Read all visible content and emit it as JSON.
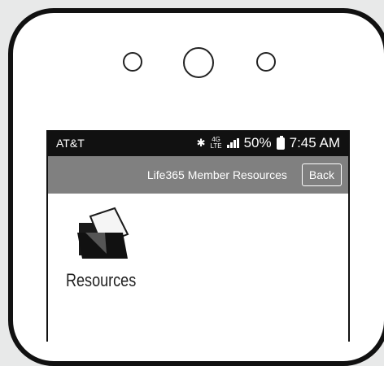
{
  "statusbar": {
    "carrier": "AT&T",
    "network": "4G",
    "network_sub": "LTE",
    "battery_text": "50%",
    "time": "7:45 AM"
  },
  "appbar": {
    "title": "Life365 Member Resources",
    "back_label": "Back"
  },
  "main": {
    "items": [
      {
        "label": "Resources",
        "icon": "folder-document-icon"
      }
    ]
  },
  "colors": {
    "background": "#e8e9e9",
    "statusbar": "#111111",
    "appbar": "#808080",
    "phone_frame": "#111111"
  }
}
